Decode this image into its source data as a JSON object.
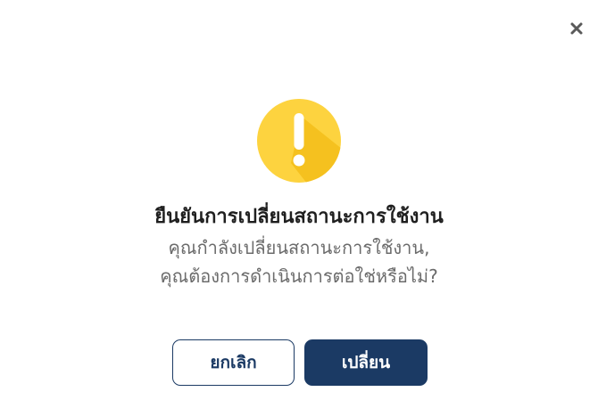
{
  "dialog": {
    "close_icon": "close-icon",
    "status_icon": "warning-exclamation-icon",
    "title": "ยืนยันการเปลี่ยนสถานะการใช้งาน",
    "message_line_1": "คุณกำลังเปลี่ยนสถานะการใช้งาน,",
    "message_line_2": "คุณต้องการดำเนินการต่อใช่หรือไม่?",
    "cancel_label": "ยกเลิก",
    "confirm_label": "เปลี่ยน"
  },
  "colors": {
    "primary": "#1b3a64",
    "warning": "#fdd33f",
    "warning_shade": "#f5c11f",
    "title_text": "#1f1f1f",
    "body_text": "#6b6b6b"
  }
}
